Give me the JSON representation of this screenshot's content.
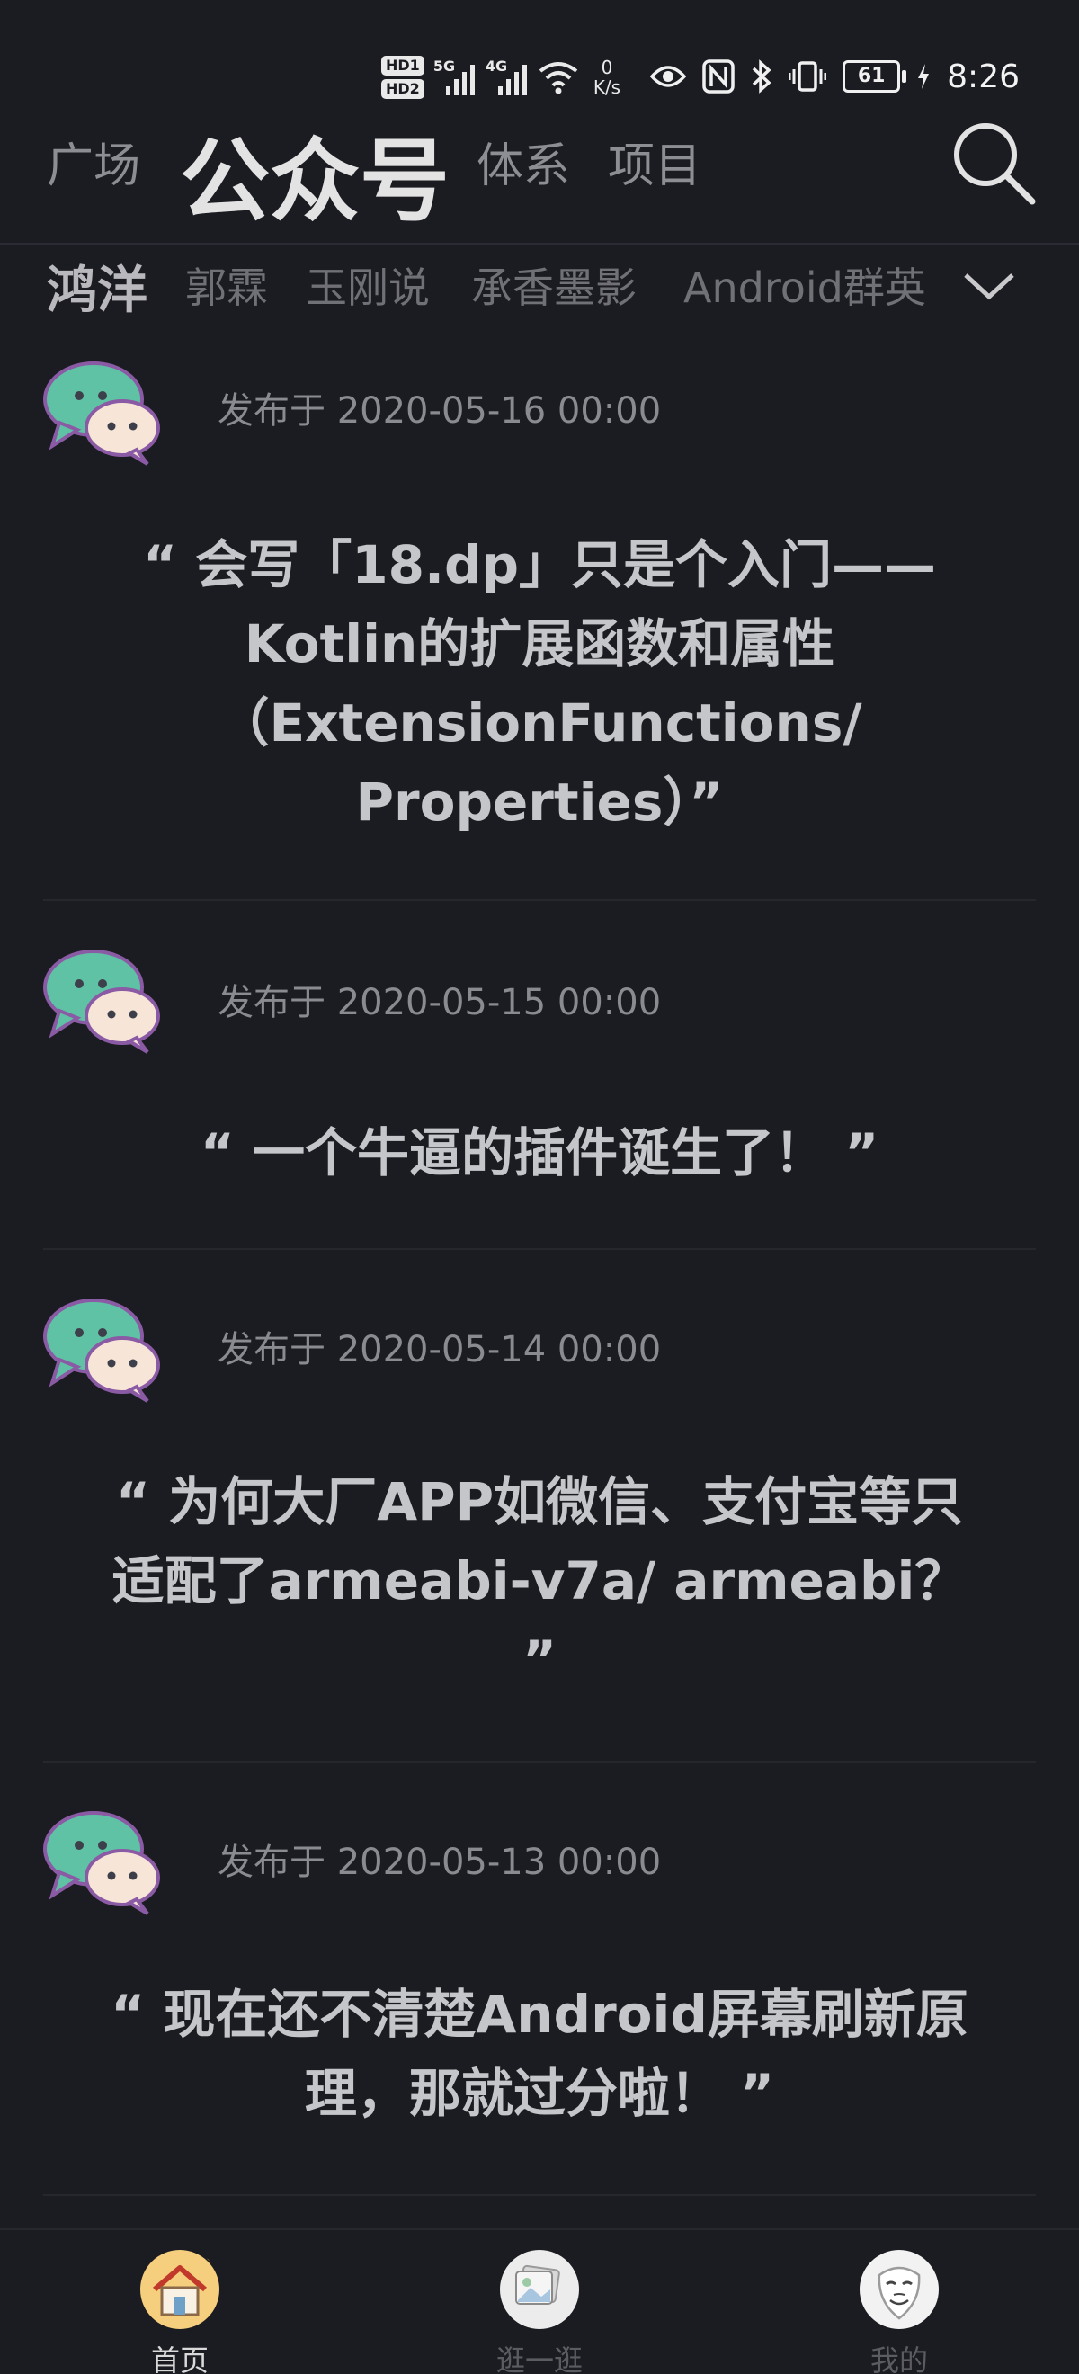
{
  "status_bar": {
    "hd1": "HD1",
    "hd2": "HD2",
    "sim1_type": "5G",
    "sim2_type": "4G",
    "net_speed_value": "0",
    "net_speed_unit": "K/s",
    "battery": "61",
    "time": "8:26"
  },
  "top_tabs": [
    "广场",
    "公众号",
    "体系",
    "项目"
  ],
  "active_top_tab": "公众号",
  "sub_tabs": [
    "鸿洋",
    "郭霖",
    "玉刚说",
    "承香墨影",
    "Android群英"
  ],
  "active_sub_tab": "鸿洋",
  "articles": [
    {
      "date": "发布于 2020-05-16 00:00",
      "title": "“ 会写「18.dp」只是个入门——Kotlin的扩展函数和属性（ExtensionFunctions/ Properties）”"
    },
    {
      "date": "发布于 2020-05-15 00:00",
      "title": "“ 一个牛逼的插件诞生了！ ”"
    },
    {
      "date": "发布于 2020-05-14 00:00",
      "title": "“ 为何大厂APP如微信、支付宝等只适配了armeabi-v7a/ armeabi？ ”"
    },
    {
      "date": "发布于 2020-05-13 00:00",
      "title": "“ 现在还不清楚Android屏幕刷新原理，那就过分啦！ ”"
    }
  ],
  "bottom_nav": [
    {
      "label": "首页",
      "icon": "home-icon"
    },
    {
      "label": "逛一逛",
      "icon": "gallery-icon"
    },
    {
      "label": "我的",
      "icon": "mask-icon"
    }
  ],
  "colors": {
    "background": "#1b1c21",
    "avatar_teal": "#5fc2a4",
    "avatar_cream": "#f7e6d8",
    "avatar_outline": "#8b5aa5",
    "home_bg": "#f5cf7d"
  }
}
